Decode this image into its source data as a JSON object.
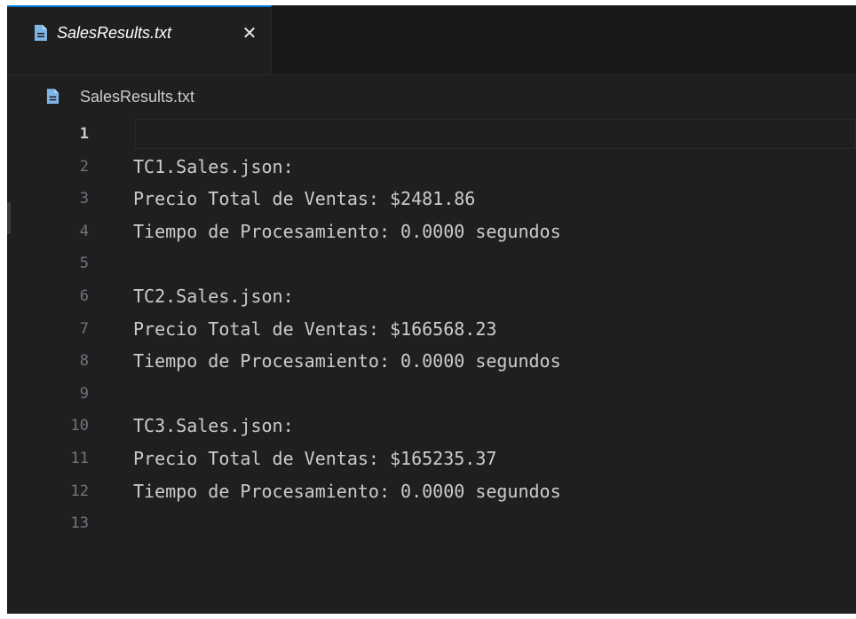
{
  "tab": {
    "label": "SalesResults.txt",
    "close_glyph": "✕",
    "icon": "file-text-icon"
  },
  "breadcrumb": {
    "label": "SalesResults.txt",
    "icon": "file-text-icon"
  },
  "editor": {
    "active_line": 1,
    "lines": [
      {
        "number": "1",
        "text": ""
      },
      {
        "number": "2",
        "text": "TC1.Sales.json:"
      },
      {
        "number": "3",
        "text": "Precio Total de Ventas: $2481.86"
      },
      {
        "number": "4",
        "text": "Tiempo de Procesamiento: 0.0000 segundos"
      },
      {
        "number": "5",
        "text": ""
      },
      {
        "number": "6",
        "text": "TC2.Sales.json:"
      },
      {
        "number": "7",
        "text": "Precio Total de Ventas: $166568.23"
      },
      {
        "number": "8",
        "text": "Tiempo de Procesamiento: 0.0000 segundos"
      },
      {
        "number": "9",
        "text": ""
      },
      {
        "number": "10",
        "text": "TC3.Sales.json:"
      },
      {
        "number": "11",
        "text": "Precio Total de Ventas: $165235.37"
      },
      {
        "number": "12",
        "text": "Tiempo de Procesamiento: 0.0000 segundos"
      },
      {
        "number": "13",
        "text": ""
      }
    ]
  },
  "colors": {
    "editor_background": "#1f1f1f",
    "tab_active_border": "#0078d4",
    "text": "#cccccc",
    "line_number": "#6e7681"
  }
}
